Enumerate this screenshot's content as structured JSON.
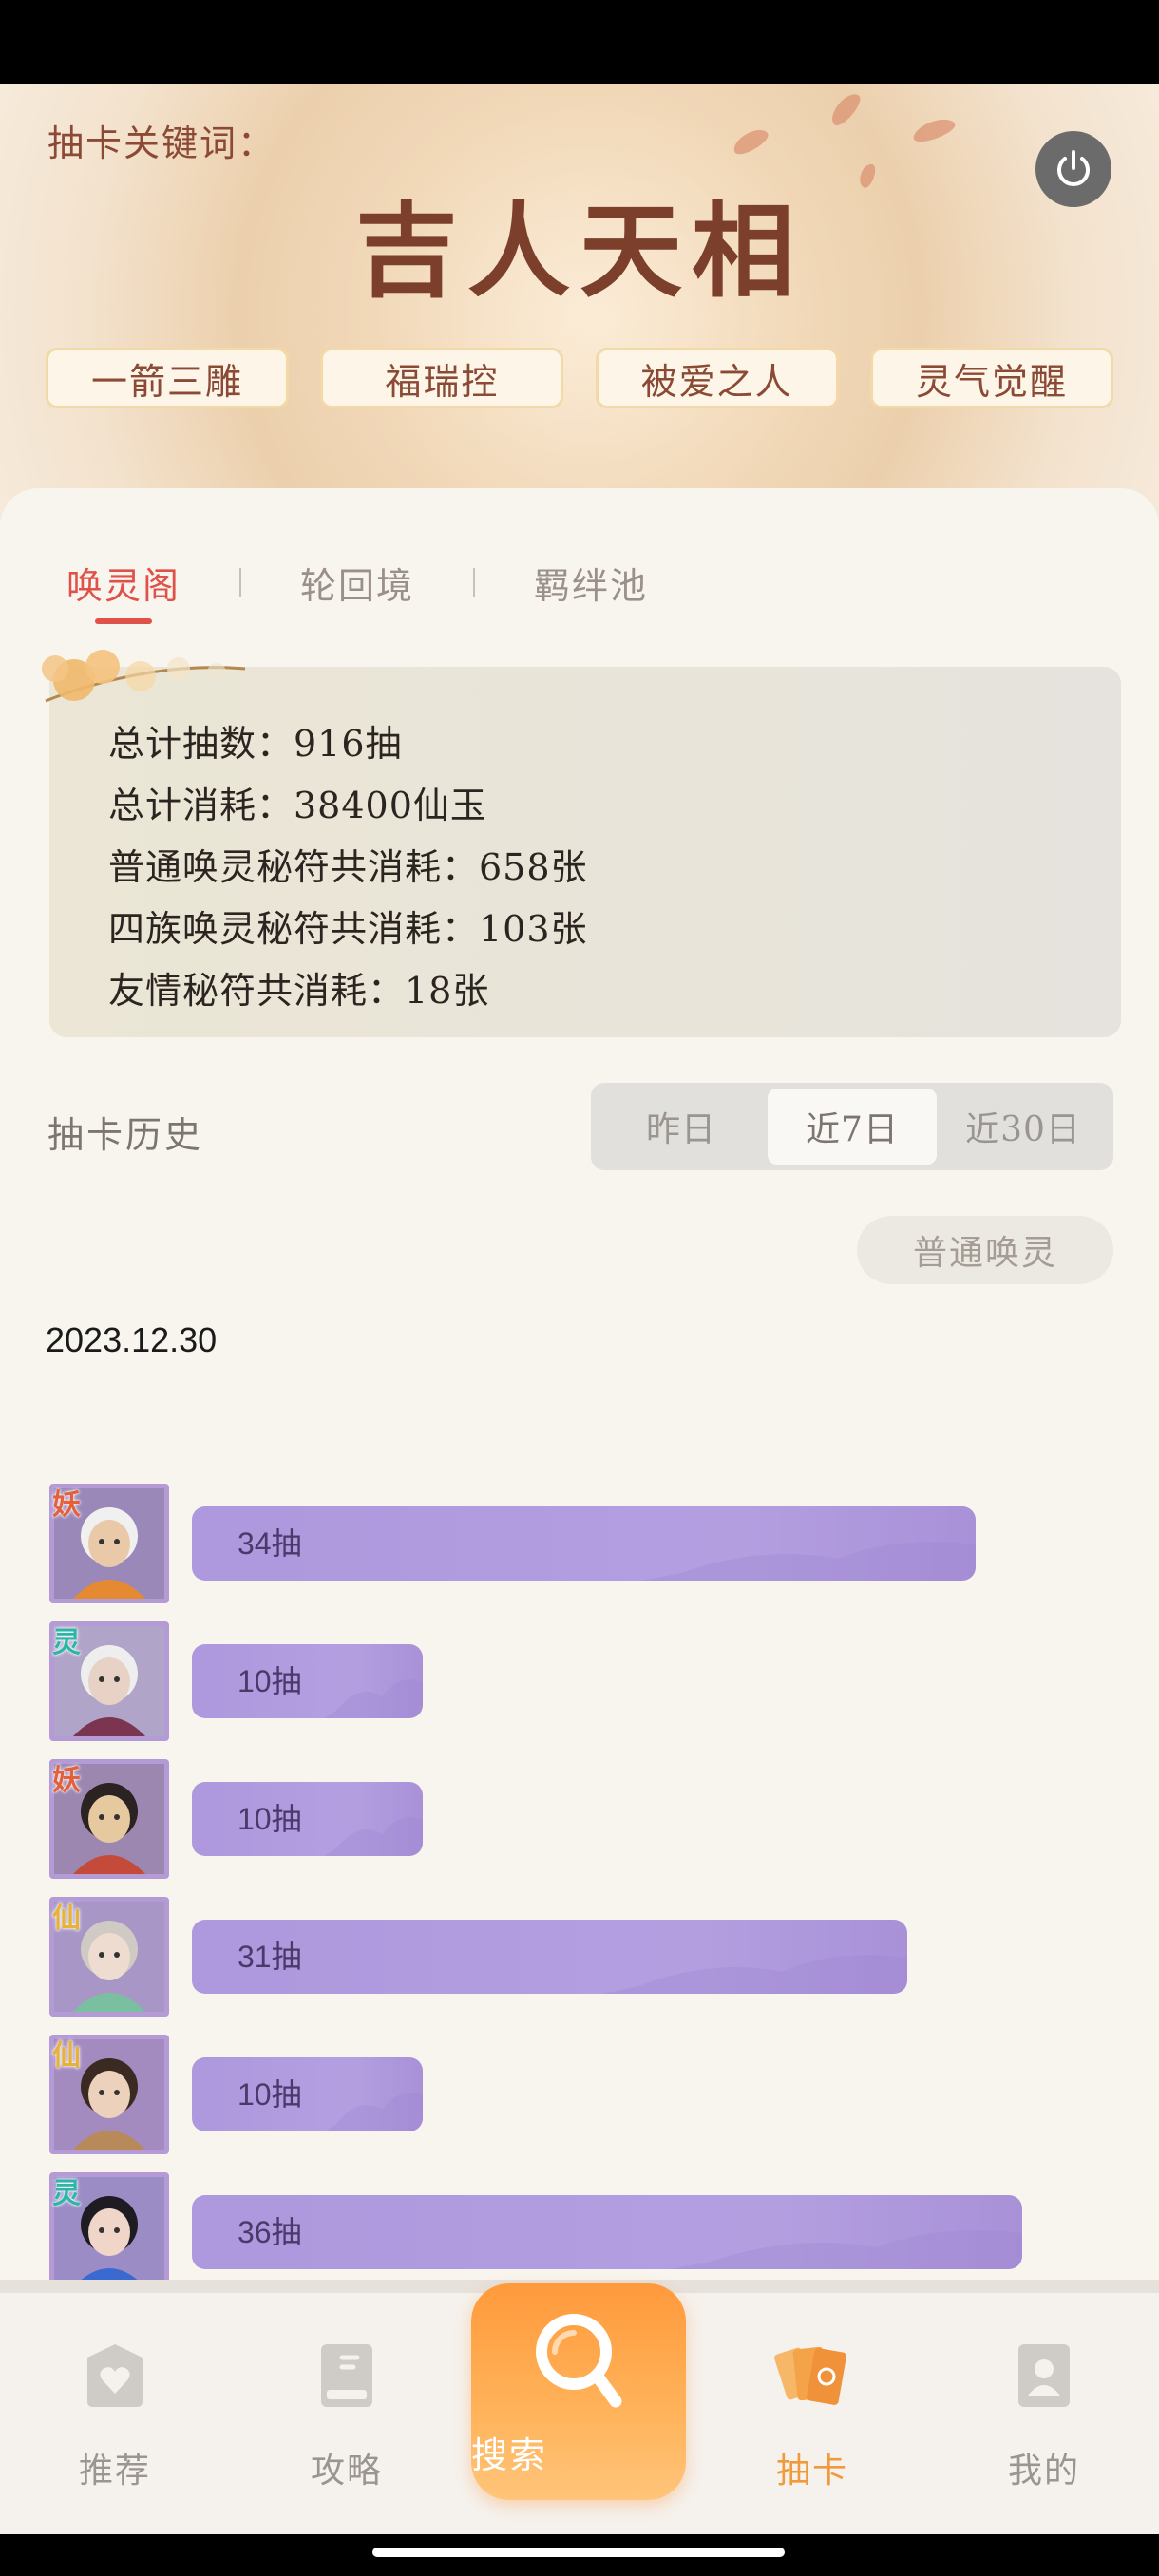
{
  "header": {
    "keyword_label": "抽卡关键词：",
    "keyword_title": "吉人天相",
    "tags": [
      "一箭三雕",
      "福瑞控",
      "被爱之人",
      "灵气觉醒"
    ]
  },
  "tabs": [
    {
      "label": "唤灵阁",
      "active": true
    },
    {
      "label": "轮回境",
      "active": false
    },
    {
      "label": "羁绊池",
      "active": false
    }
  ],
  "stats": [
    "总计抽数：916抽",
    "总计消耗：38400仙玉",
    "普通唤灵秘符共消耗：658张",
    "四族唤灵秘符共消耗：103张",
    "友情秘符共消耗：18张"
  ],
  "history": {
    "title": "抽卡历史",
    "ranges": [
      {
        "label": "昨日",
        "active": false
      },
      {
        "label": "近7日",
        "active": true
      },
      {
        "label": "近30日",
        "active": false
      }
    ],
    "filter": "普通唤灵",
    "date": "2023.12.30",
    "max_pulls": 36,
    "entries": [
      {
        "badge": "妖",
        "badge_color": "#e4603a",
        "pulls": 34,
        "label": "34抽"
      },
      {
        "badge": "灵",
        "badge_color": "#2bb6a8",
        "pulls": 10,
        "label": "10抽"
      },
      {
        "badge": "妖",
        "badge_color": "#e4603a",
        "pulls": 10,
        "label": "10抽"
      },
      {
        "badge": "仙",
        "badge_color": "#e5b23a",
        "pulls": 31,
        "label": "31抽"
      },
      {
        "badge": "仙",
        "badge_color": "#e5b23a",
        "pulls": 10,
        "label": "10抽"
      },
      {
        "badge": "灵",
        "badge_color": "#2bb6a8",
        "pulls": 36,
        "label": "36抽"
      }
    ]
  },
  "nav": [
    {
      "label": "推荐",
      "icon": "heart-shield-icon",
      "active": false
    },
    {
      "label": "攻略",
      "icon": "book-icon",
      "active": false
    },
    {
      "label": "搜索",
      "icon": "search-icon",
      "active": false
    },
    {
      "label": "抽卡",
      "icon": "cards-icon",
      "active": true
    },
    {
      "label": "我的",
      "icon": "profile-icon",
      "active": false
    }
  ],
  "colors": {
    "accent_red": "#e0514a",
    "accent_orange": "#f09a3b",
    "bar_purple": "#b39fe0"
  }
}
